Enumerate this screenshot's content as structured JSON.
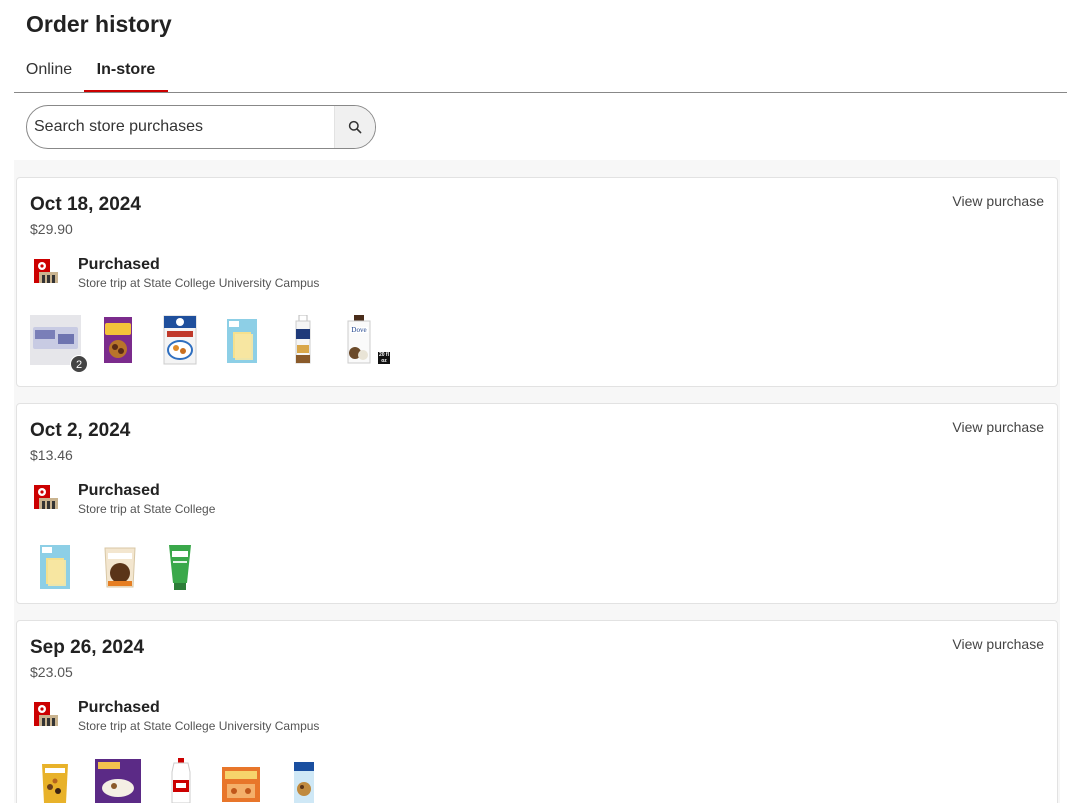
{
  "page": {
    "title": "Order history"
  },
  "tabs": [
    {
      "label": "Online",
      "active": false
    },
    {
      "label": "In-store",
      "active": true
    }
  ],
  "search": {
    "placeholder": "Search store purchases",
    "value": ""
  },
  "colors": {
    "accent": "#cc0000",
    "text": "#333333",
    "muted": "#555555",
    "panel": "#f7f7f7"
  },
  "orders": [
    {
      "date": "Oct 18, 2024",
      "total": "$29.90",
      "status": "Purchased",
      "store": "Store trip at State College University Campus",
      "view_label": "View purchase",
      "items": [
        {
          "name": "Litter box",
          "icon": "box-product-icon",
          "badge": "2"
        },
        {
          "name": "Raisin Bran cereal",
          "icon": "cereal-box-icon",
          "box_label": "Raisin Bran"
        },
        {
          "name": "Quaker oat cereal",
          "icon": "cereal-box-icon"
        },
        {
          "name": "Sliced cheese",
          "icon": "cheese-pack-icon"
        },
        {
          "name": "Head & Shoulders shampoo",
          "icon": "shampoo-bottle-icon"
        },
        {
          "name": "Dove body wash",
          "icon": "bodywash-bottle-icon",
          "box_label": "Dove",
          "size_badge": "20 fl oz"
        }
      ]
    },
    {
      "date": "Oct 2, 2024",
      "total": "$13.46",
      "status": "Purchased",
      "store": "Store trip at State College",
      "view_label": "View purchase",
      "items": [
        {
          "name": "Sliced cheese",
          "icon": "cheese-pack-icon"
        },
        {
          "name": "Chocolate chips bag",
          "icon": "snack-bag-icon"
        },
        {
          "name": "Simple face wash",
          "icon": "tube-icon"
        }
      ]
    },
    {
      "date": "Sep 26, 2024",
      "total": "$23.05",
      "status": "Purchased",
      "store": "Store trip at State College University Campus",
      "view_label": "View purchase",
      "items": [
        {
          "name": "Trail mix bag",
          "icon": "snack-bag-icon"
        },
        {
          "name": "Oatmeal box",
          "icon": "cereal-box-icon"
        },
        {
          "name": "Milk jug",
          "icon": "milk-jug-icon"
        },
        {
          "name": "Cheese crackers",
          "icon": "cracker-box-icon"
        },
        {
          "name": "Cereal bag",
          "icon": "cereal-box-icon"
        }
      ]
    }
  ]
}
